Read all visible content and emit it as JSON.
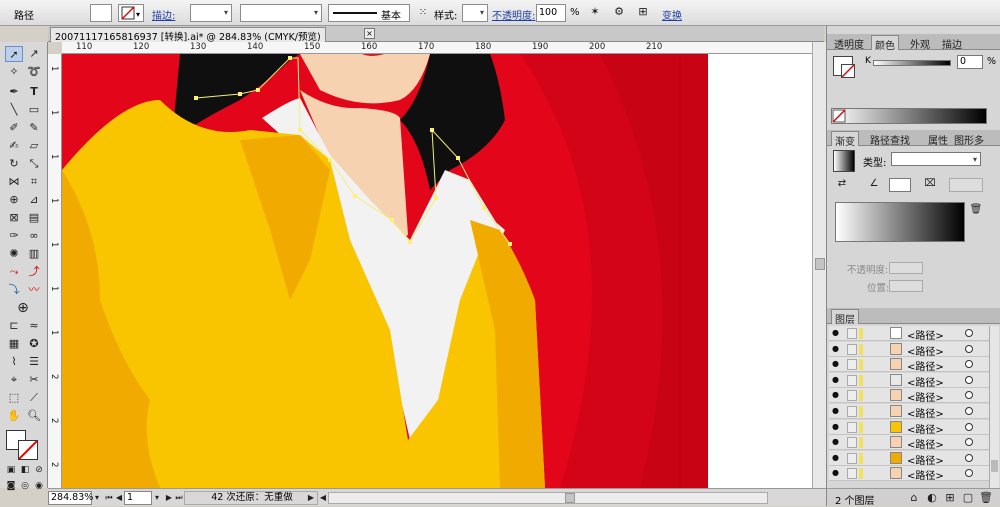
{
  "control_bar": {
    "object_type": "路径",
    "stroke_label": "描边:",
    "stroke_profile": "基本",
    "style_label": "样式:",
    "opacity_label": "不透明度:",
    "opacity_value": "100",
    "opacity_unit": "%",
    "transform_label": "变换"
  },
  "document_tab": {
    "title": "20071117165816937 [转换].ai* @ 284.83% (CMYK/预览)",
    "close_glyph": "×"
  },
  "ruler": {
    "h_labels": [
      "110",
      "120",
      "130",
      "140",
      "150",
      "160",
      "170",
      "180",
      "190",
      "200",
      "210"
    ],
    "v_labels": [
      "1",
      "1",
      "1",
      "1",
      "1",
      "1",
      "1",
      "2",
      "2",
      "2"
    ]
  },
  "status_bar": {
    "zoom": "284.83%",
    "artboard": "1",
    "status_text": "42 次还原：无重做"
  },
  "colors": {
    "background_red": "#e3051a",
    "jacket_yellow": "#f9c400",
    "jacket_shadow": "#f1ab00",
    "hair": "#0f0f0f",
    "skin": "#f6d2b0",
    "shirt": "#f2f2f2",
    "anchor": "#fff176"
  },
  "panel_top": {
    "tabs": [
      "透明度",
      "颜色",
      "外观",
      "描边"
    ],
    "active_tab": "颜色",
    "k_label": "K",
    "k_value": "0",
    "k_unit": "%"
  },
  "panel_gradient": {
    "tabs": [
      "渐变",
      "路径查找",
      "属性",
      "图形多"
    ],
    "active_tab": "渐变",
    "type_label": "类型:",
    "opacity_label": "不透明度:",
    "location_label": "位置:"
  },
  "layers_panel": {
    "tab": "图层",
    "items": [
      "<路径>",
      "<路径>",
      "<路径>",
      "<路径>",
      "<路径>",
      "<路径>",
      "<路径>",
      "<路径>",
      "<路径>",
      "<路径>"
    ],
    "footer": "2 个图层"
  }
}
